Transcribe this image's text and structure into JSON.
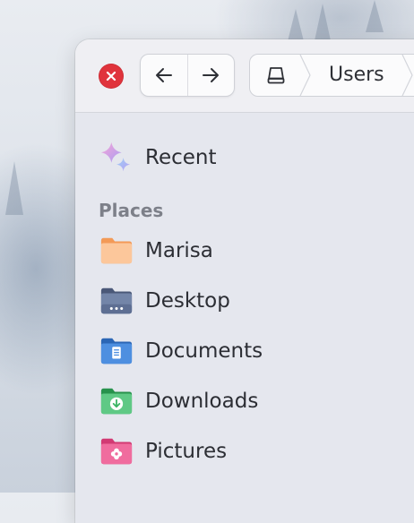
{
  "window": {
    "nav": {
      "back_icon": "arrow-left-icon",
      "forward_icon": "arrow-right-icon"
    },
    "path_bar": {
      "drive_icon": "drive-icon",
      "current": "Users"
    },
    "close_icon": "close-icon"
  },
  "sidebar": {
    "recent": {
      "label": "Recent",
      "icon": "sparkles-icon"
    },
    "places_header": "Places",
    "places": [
      {
        "label": "Marisa",
        "icon": "home-folder-icon",
        "color": "#f7b47d"
      },
      {
        "label": "Desktop",
        "icon": "desktop-folder-icon",
        "color": "#5e6f93"
      },
      {
        "label": "Documents",
        "icon": "documents-folder-icon",
        "color": "#3f7fd3"
      },
      {
        "label": "Downloads",
        "icon": "downloads-folder-icon",
        "color": "#3cb465"
      },
      {
        "label": "Pictures",
        "icon": "pictures-folder-icon",
        "color": "#ec4f8a"
      }
    ]
  },
  "colors": {
    "close": "#e0333c",
    "window_bg": "#e5e7ee"
  }
}
